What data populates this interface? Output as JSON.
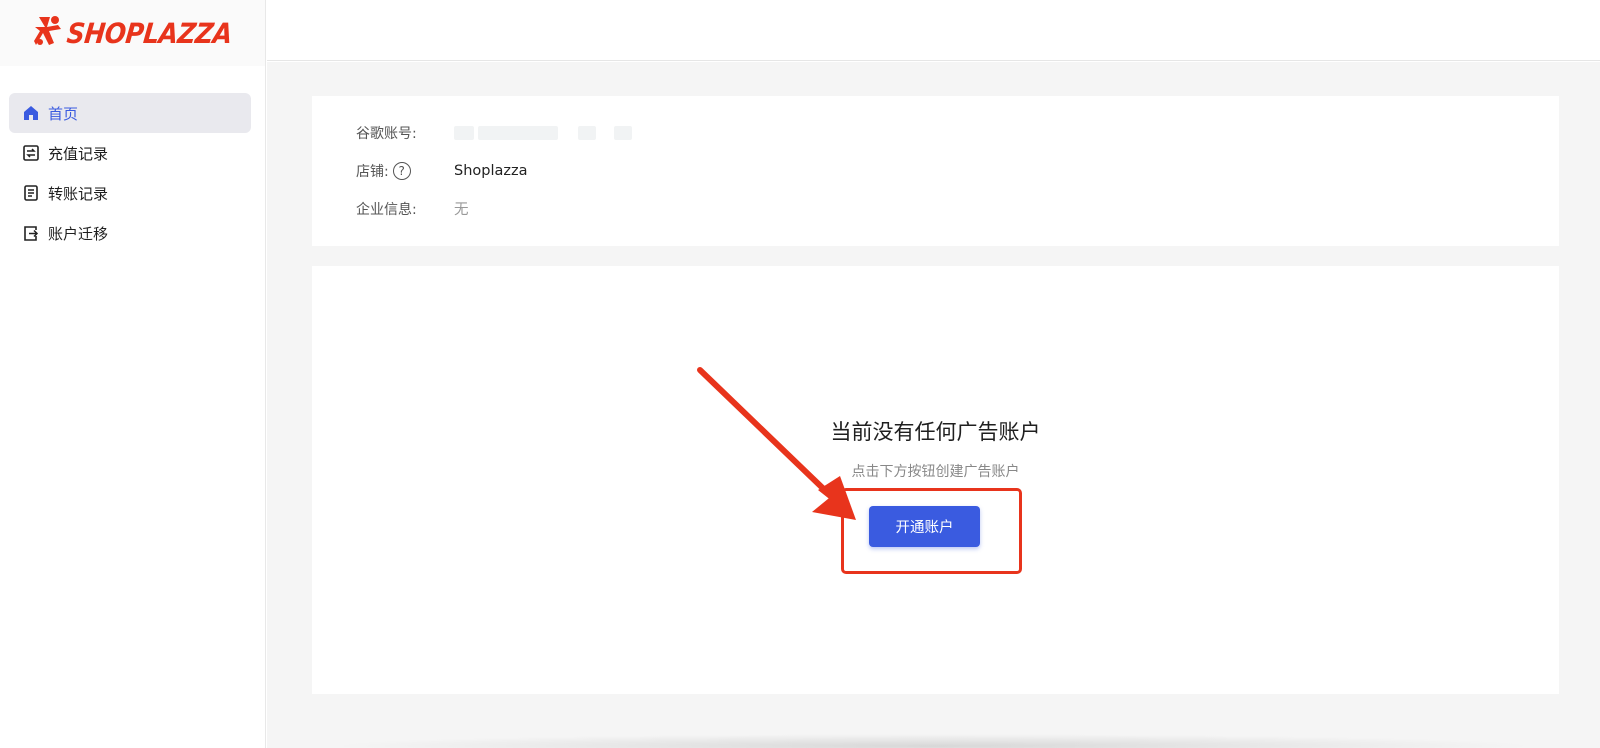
{
  "brand": {
    "name": "SHOPLAZZA",
    "color": "#e8341c"
  },
  "sidebar": {
    "items": [
      {
        "label": "首页",
        "icon": "home-icon",
        "active": true
      },
      {
        "label": "充值记录",
        "icon": "transfer-icon",
        "active": false
      },
      {
        "label": "转账记录",
        "icon": "document-icon",
        "active": false
      },
      {
        "label": "账户迁移",
        "icon": "migrate-icon",
        "active": false
      }
    ]
  },
  "info": {
    "google_account_label": "谷歌账号:",
    "store_label": "店铺:",
    "store_value": "Shoplazza",
    "company_label": "企业信息:",
    "company_value": "无",
    "help_glyph": "?"
  },
  "empty_state": {
    "title": "当前没有任何广告账户",
    "subtitle": "点击下方按钮创建广告账户",
    "button_label": "开通账户"
  },
  "colors": {
    "accent": "#3a5be0",
    "annotation": "#e8341c",
    "page_bg": "#f5f5f5"
  }
}
